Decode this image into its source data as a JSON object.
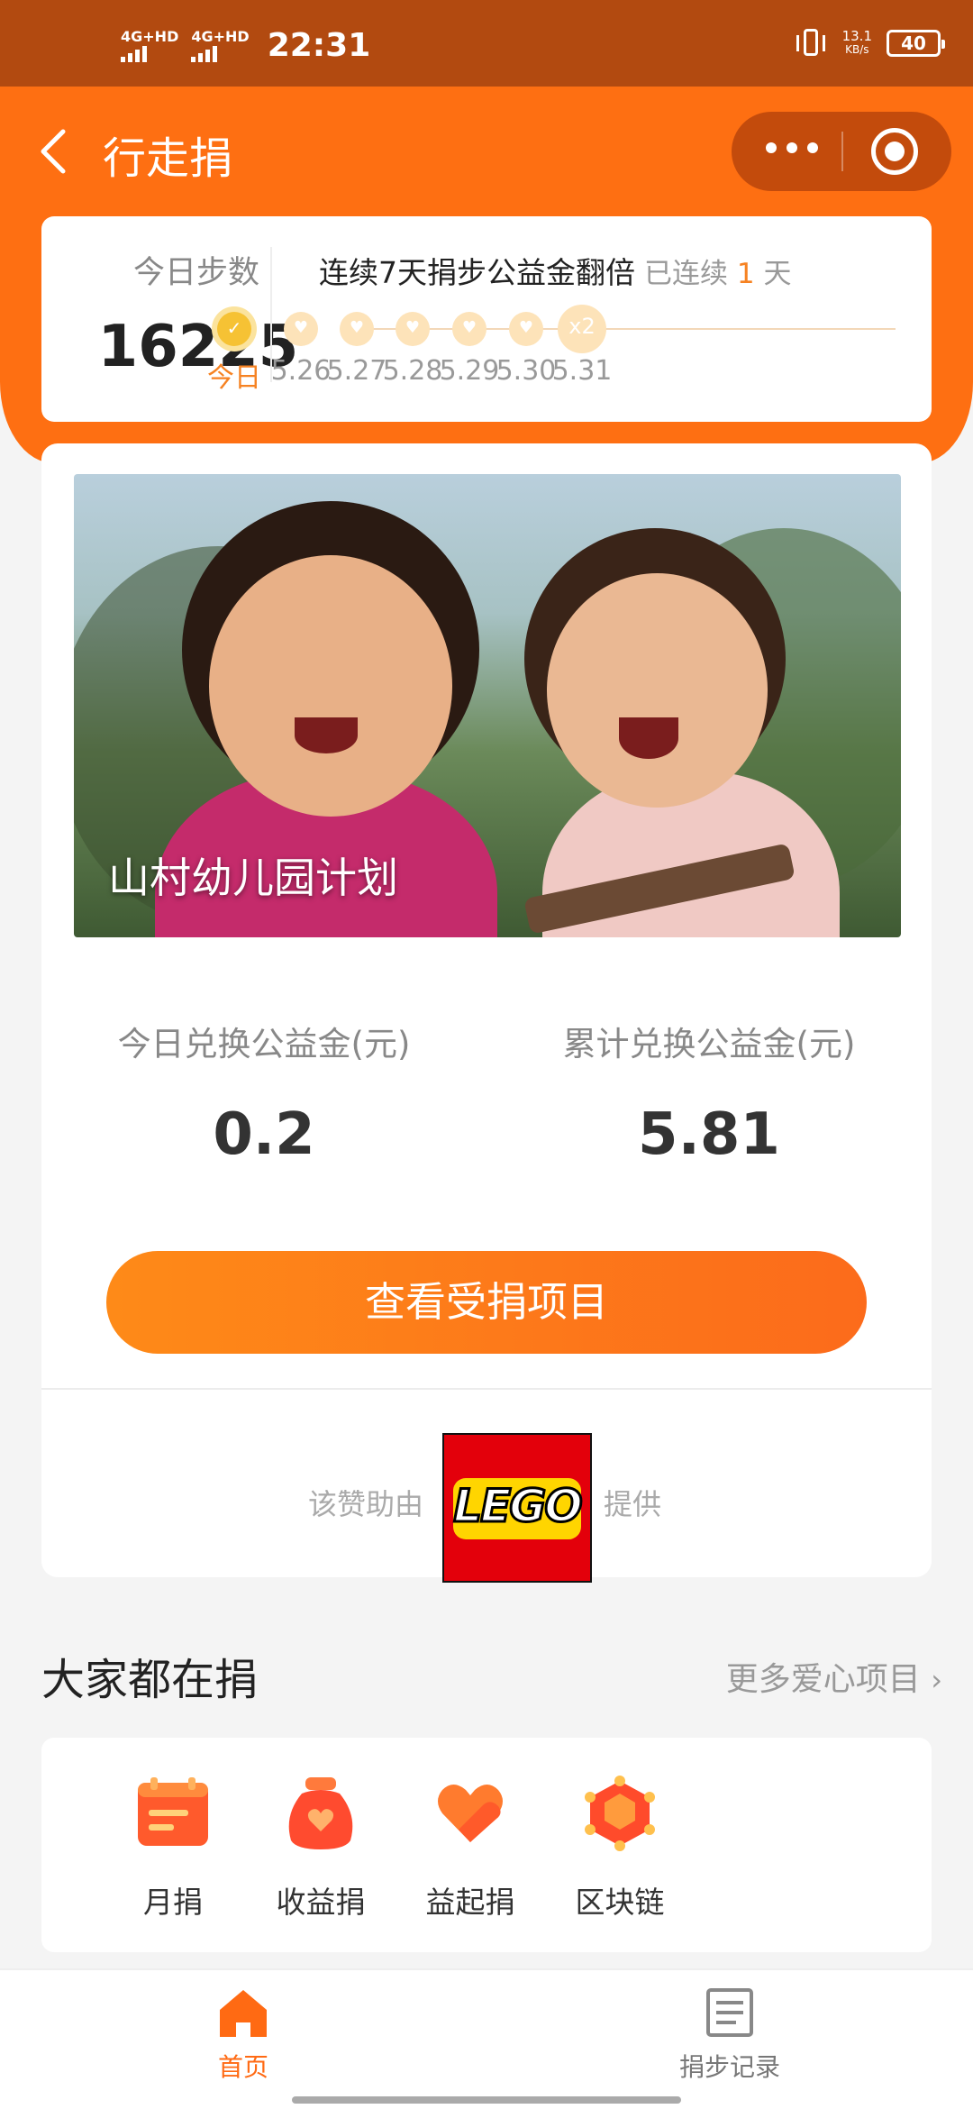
{
  "status_bar": {
    "network1": "4G+HD",
    "network2": "4G+HD",
    "time": "22:31",
    "speed_value": "13.1",
    "speed_unit": "KB/s",
    "battery": "40"
  },
  "header": {
    "title": "行走捐",
    "back_icon": "chevron-left-icon",
    "more_icon": "more-dots-icon",
    "close_icon": "target-circle-icon"
  },
  "steps": {
    "today_label": "今日步数",
    "today_count": "16225",
    "streak_title": "连续7天捐步公益金翻倍",
    "streak_prefix": "已连续",
    "streak_days": "1",
    "streak_suffix": "天",
    "days": [
      {
        "label": "今日",
        "state": "done"
      },
      {
        "label": "5.26",
        "state": "pending"
      },
      {
        "label": "5.27",
        "state": "pending"
      },
      {
        "label": "5.28",
        "state": "pending"
      },
      {
        "label": "5.29",
        "state": "pending"
      },
      {
        "label": "5.30",
        "state": "pending"
      },
      {
        "label": "5.31",
        "state": "double"
      }
    ],
    "double_badge": "x2"
  },
  "project": {
    "title": "山村幼儿园计划",
    "today_label": "今日兑换公益金(元)",
    "today_value": "0.2",
    "total_label": "累计兑换公益金(元)",
    "total_value": "5.81",
    "cta_label": "查看受捐项目",
    "sponsor_prefix": "该赞助由",
    "sponsor_brand": "LEGO",
    "sponsor_suffix": "提供"
  },
  "section": {
    "title": "大家都在捐",
    "more_label": "更多爱心项目",
    "items": [
      {
        "label": "月捐",
        "icon": "calendar-icon"
      },
      {
        "label": "收益捐",
        "icon": "money-bag-icon"
      },
      {
        "label": "益起捐",
        "icon": "heart-icon"
      },
      {
        "label": "区块链",
        "icon": "blockchain-cube-icon"
      }
    ]
  },
  "tabbar": {
    "tabs": [
      {
        "label": "首页",
        "icon": "home-icon",
        "active": true
      },
      {
        "label": "捐步记录",
        "icon": "record-list-icon",
        "active": false
      }
    ]
  },
  "colors": {
    "brand": "#fe6f12",
    "status_bar": "#b24a10",
    "accent": "#f68222"
  }
}
